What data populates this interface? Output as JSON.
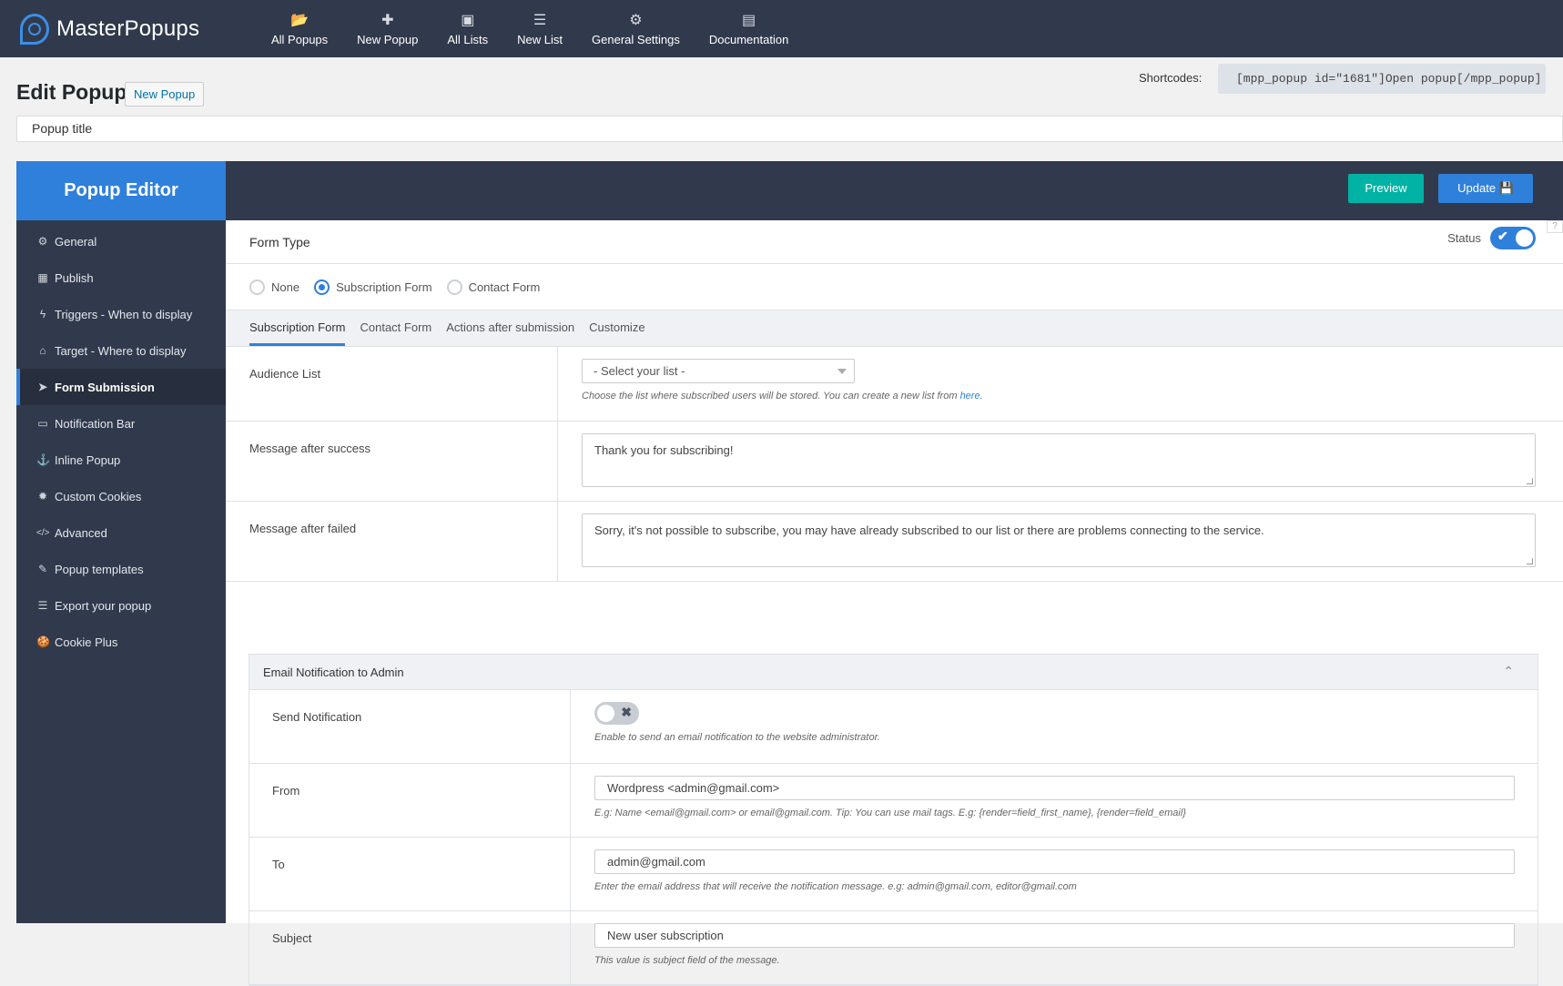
{
  "topbar": {
    "logo_text": "MasterPopups",
    "nav": [
      {
        "label": "All Popups",
        "icon": "folder-open-icon",
        "glyph": "📂"
      },
      {
        "label": "New Popup",
        "icon": "plus-icon",
        "glyph": "✚"
      },
      {
        "label": "All Lists",
        "icon": "address-book-icon",
        "glyph": "▣"
      },
      {
        "label": "New List",
        "icon": "list-icon",
        "glyph": "☰"
      },
      {
        "label": "General Settings",
        "icon": "gear-icon",
        "glyph": "⚙"
      },
      {
        "label": "Documentation",
        "icon": "document-icon",
        "glyph": "▤"
      }
    ]
  },
  "page": {
    "title": "Edit Popup",
    "new_popup_label": "New Popup",
    "shortcodes_label": "Shortcodes:",
    "shortcode": "[mpp_popup id=\"1681\"]Open popup[/mpp_popup]",
    "popup_title_value": "Popup title"
  },
  "editor": {
    "heading": "Popup Editor",
    "preview_label": "Preview",
    "update_label": "Update",
    "help_label": "?",
    "sidebar": [
      {
        "label": "General",
        "icon": "gear-icon",
        "glyph": "⚙"
      },
      {
        "label": "Publish",
        "icon": "calendar-icon",
        "glyph": "▦"
      },
      {
        "label": "Triggers - When to display",
        "icon": "bolt-icon",
        "glyph": "ϟ"
      },
      {
        "label": "Target - Where to display",
        "icon": "home-icon",
        "glyph": "⌂"
      },
      {
        "label": "Form Submission",
        "icon": "paper-plane-icon",
        "glyph": "➤",
        "active": true
      },
      {
        "label": "Notification Bar",
        "icon": "credit-card-icon",
        "glyph": "▭"
      },
      {
        "label": "Inline Popup",
        "icon": "anchor-icon",
        "glyph": "⚓"
      },
      {
        "label": "Custom Cookies",
        "icon": "cookie-icon",
        "glyph": "✹"
      },
      {
        "label": "Advanced",
        "icon": "code-icon",
        "glyph": "</>"
      },
      {
        "label": "Popup templates",
        "icon": "brush-icon",
        "glyph": "✎"
      },
      {
        "label": "Export your popup",
        "icon": "database-icon",
        "glyph": "☰"
      },
      {
        "label": "Cookie Plus",
        "icon": "cookie-plus-icon",
        "glyph": "🍪"
      }
    ]
  },
  "form": {
    "form_type_label": "Form Type",
    "status_label": "Status",
    "status_on": true,
    "radios": [
      {
        "label": "None",
        "checked": false
      },
      {
        "label": "Subscription Form",
        "checked": true
      },
      {
        "label": "Contact Form",
        "checked": false
      }
    ],
    "tabs": [
      {
        "label": "Subscription Form",
        "active": true
      },
      {
        "label": "Contact Form",
        "active": false
      },
      {
        "label": "Actions after submission",
        "active": false
      },
      {
        "label": "Customize",
        "active": false
      }
    ],
    "audience_label": "Audience List",
    "audience_select": "- Select your list -",
    "audience_hint": "Choose the list where subscribed users will be stored. You can create a new list from ",
    "audience_hint_link": "here",
    "success_label": "Message after success",
    "success_value": "Thank you for subscribing!",
    "failed_label": "Message after failed",
    "failed_value": "Sorry, it's not possible to subscribe, you may have already subscribed to our list or there are problems connecting to the service."
  },
  "notification": {
    "heading": "Email Notification to Admin",
    "send_label": "Send Notification",
    "send_enabled": false,
    "send_hint": "Enable to send an email notification to the website administrator.",
    "from_label": "From",
    "from_value": "Wordpress <admin@gmail.com>",
    "from_hint": "E.g: Name <email@gmail.com> or email@gmail.com. Tip: You can use mail tags. E.g: {render=field_first_name}, {render=field_email}",
    "to_label": "To",
    "to_value": "admin@gmail.com",
    "to_hint": "Enter the email address that will receive the notification message. e.g: admin@gmail.com, editor@gmail.com",
    "subject_label": "Subject",
    "subject_value": "New user subscription",
    "subject_hint": "This value is subject field of the message."
  }
}
